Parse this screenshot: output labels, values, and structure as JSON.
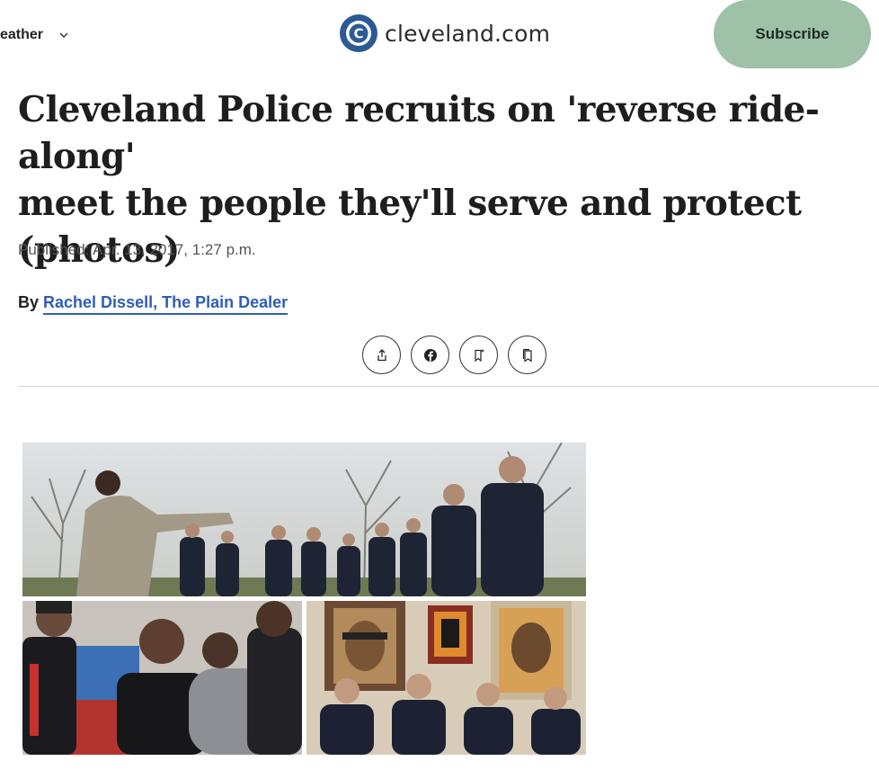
{
  "header": {
    "nav_weather_label": "eather",
    "logo_text": "cleveland.com",
    "logo_letter": "C",
    "subscribe_label": "Subscribe"
  },
  "article": {
    "headline_line1": "Cleveland Police recruits on 'reverse ride-along'",
    "headline_line2": "meet the people they'll serve and protect",
    "headline_line3": "(photos)",
    "published": "Published: Apr. 13, 2017, 1:27 p.m.",
    "by_label": "By",
    "author": "Rachel Dissell, The Plain Dealer"
  },
  "share": {
    "icons": [
      "share-icon",
      "facebook-icon",
      "bookmark-add-icon",
      "bookmarks-icon"
    ]
  },
  "colors": {
    "subscribe_bg": "#9ec1a8",
    "logo_blue": "#2d5a94",
    "author_link": "#2f5db7"
  }
}
